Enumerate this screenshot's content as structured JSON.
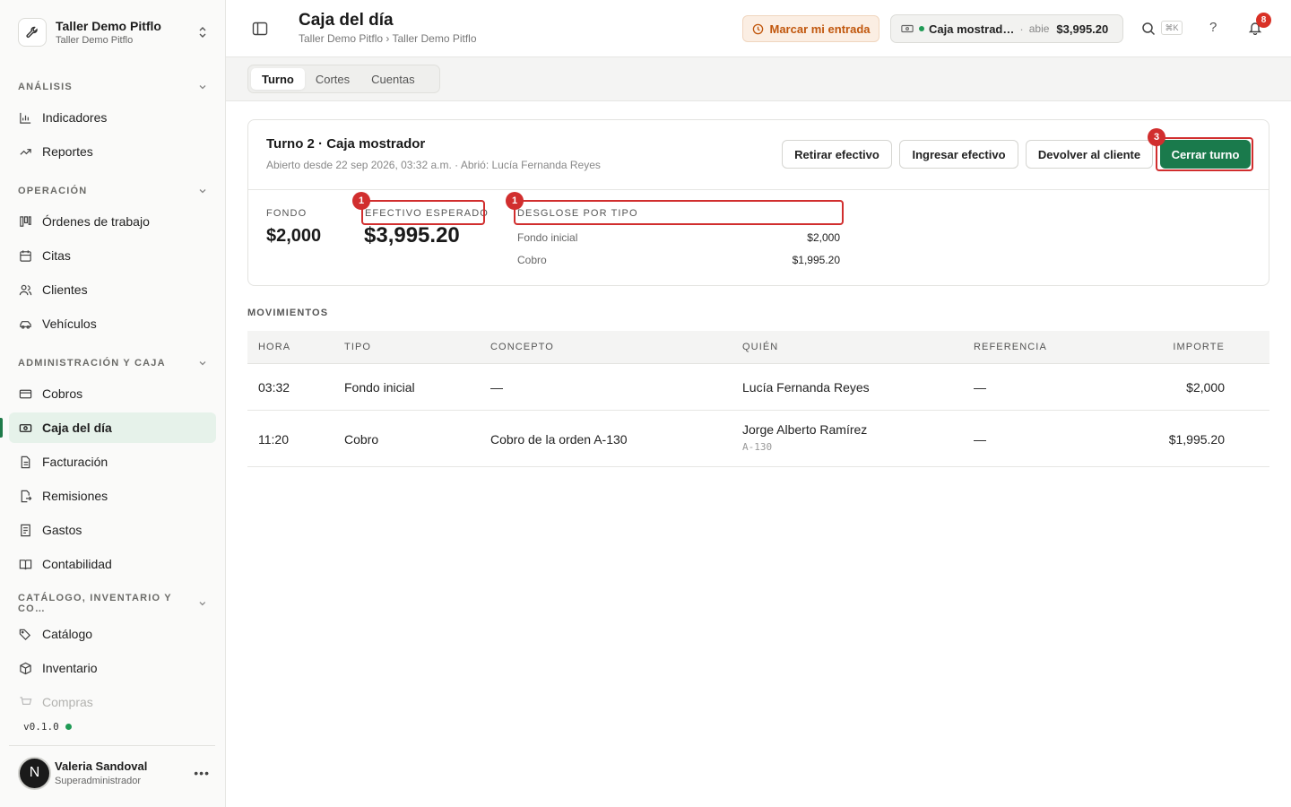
{
  "org": {
    "name": "Taller Demo Pitflo",
    "subtitle": "Taller Demo Pitflo"
  },
  "sidebar": {
    "sections": [
      {
        "title": "ANÁLISIS",
        "items": [
          {
            "label": "Indicadores",
            "icon": "bar-chart-icon"
          },
          {
            "label": "Reportes",
            "icon": "trending-up-icon"
          }
        ]
      },
      {
        "title": "OPERACIÓN",
        "items": [
          {
            "label": "Órdenes de trabajo",
            "icon": "kanban-icon"
          },
          {
            "label": "Citas",
            "icon": "calendar-icon"
          },
          {
            "label": "Clientes",
            "icon": "users-icon"
          },
          {
            "label": "Vehículos",
            "icon": "car-icon"
          }
        ]
      },
      {
        "title": "ADMINISTRACIÓN Y CAJA",
        "items": [
          {
            "label": "Cobros",
            "icon": "credit-card-icon"
          },
          {
            "label": "Caja del día",
            "icon": "banknote-icon",
            "active": true
          },
          {
            "label": "Facturación",
            "icon": "file-text-icon"
          },
          {
            "label": "Remisiones",
            "icon": "file-export-icon"
          },
          {
            "label": "Gastos",
            "icon": "receipt-icon"
          },
          {
            "label": "Contabilidad",
            "icon": "book-icon"
          }
        ]
      },
      {
        "title": "CATÁLOGO, INVENTARIO Y CO…",
        "items": [
          {
            "label": "Catálogo",
            "icon": "tags-icon"
          },
          {
            "label": "Inventario",
            "icon": "package-icon"
          },
          {
            "label": "Compras",
            "icon": "cart-icon"
          }
        ]
      }
    ],
    "version": "v0.1.0"
  },
  "user": {
    "initial": "N",
    "name": "Valeria Sandoval",
    "role": "Superadministrador"
  },
  "header": {
    "title": "Caja del día",
    "breadcrumb": "Taller Demo Pitflo › Taller Demo Pitflo",
    "clock_in_label": "Marcar mi entrada",
    "register": {
      "name": "Caja mostrad…",
      "status": "abie",
      "amount": "$3,995.20"
    },
    "search_shortcut": "⌘K",
    "help": "?",
    "notifications": "8"
  },
  "tabs": [
    {
      "label": "Turno",
      "active": true
    },
    {
      "label": "Cortes"
    },
    {
      "label": "Cuentas"
    }
  ],
  "shift": {
    "title": "Turno 2 · Caja mostrador",
    "subtitle": "Abierto desde 22 sep 2026, 03:32 a.m. · Abrió: Lucía Fernanda Reyes",
    "actions": {
      "withdraw": "Retirar efectivo",
      "deposit": "Ingresar efectivo",
      "refund": "Devolver al cliente",
      "close": "Cerrar turno"
    },
    "fund_label": "FONDO",
    "fund_value": "$2,000",
    "expected_label": "EFECTIVO ESPERADO",
    "expected_value": "$3,995.20",
    "breakdown_label": "DESGLOSE POR TIPO",
    "breakdown": [
      {
        "label": "Fondo inicial",
        "value": "$2,000"
      },
      {
        "label": "Cobro",
        "value": "$1,995.20"
      }
    ]
  },
  "annotations": {
    "expected": "1",
    "breakdown": "1",
    "close": "3"
  },
  "movements": {
    "title": "MOVIMIENTOS",
    "columns": {
      "hora": "HORA",
      "tipo": "TIPO",
      "concepto": "CONCEPTO",
      "quien": "QUIÉN",
      "referencia": "REFERENCIA",
      "importe": "IMPORTE"
    },
    "rows": [
      {
        "hora": "03:32",
        "tipo": "Fondo inicial",
        "concepto": "—",
        "quien": "Lucía Fernanda Reyes",
        "quien_sub": "",
        "referencia": "—",
        "importe": "$2,000"
      },
      {
        "hora": "11:20",
        "tipo": "Cobro",
        "concepto": "Cobro de la orden A-130",
        "quien": "Jorge Alberto Ramírez",
        "quien_sub": "A-130",
        "referencia": "—",
        "importe": "$1,995.20"
      }
    ]
  },
  "colors": {
    "accent": "#1a7a4c",
    "highlight": "#d12e2e",
    "clock_in": "#c1570d"
  }
}
